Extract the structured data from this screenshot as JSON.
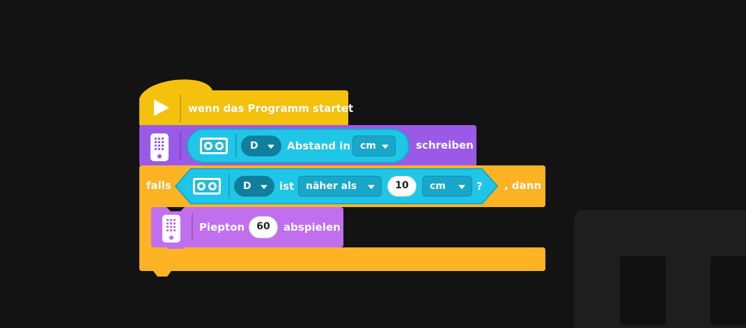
{
  "colors": {
    "background": "#131313",
    "events": "#f4c20d",
    "display": "#9b59e8",
    "control": "#fdb323",
    "sensor": "#1fc6e8",
    "sound": "#c070ee"
  },
  "blocks": {
    "hat": {
      "icon": "play-icon",
      "label": "wenn das Programm startet"
    },
    "write": {
      "icon": "hub-display-icon",
      "sensor_icon": "distance-sensor-icon",
      "port": "D",
      "label": "Abstand in",
      "unit": "cm",
      "suffix": "schreiben"
    },
    "if": {
      "prefix": "falls",
      "sensor_icon": "distance-sensor-icon",
      "port": "D",
      "word_is": "ist",
      "comparison": "näher als",
      "value": "10",
      "unit": "cm",
      "question": "?",
      "suffix": ", dann"
    },
    "beep": {
      "icon": "hub-sound-icon",
      "label": "Piepton",
      "note": "60",
      "suffix": "abspielen"
    }
  }
}
